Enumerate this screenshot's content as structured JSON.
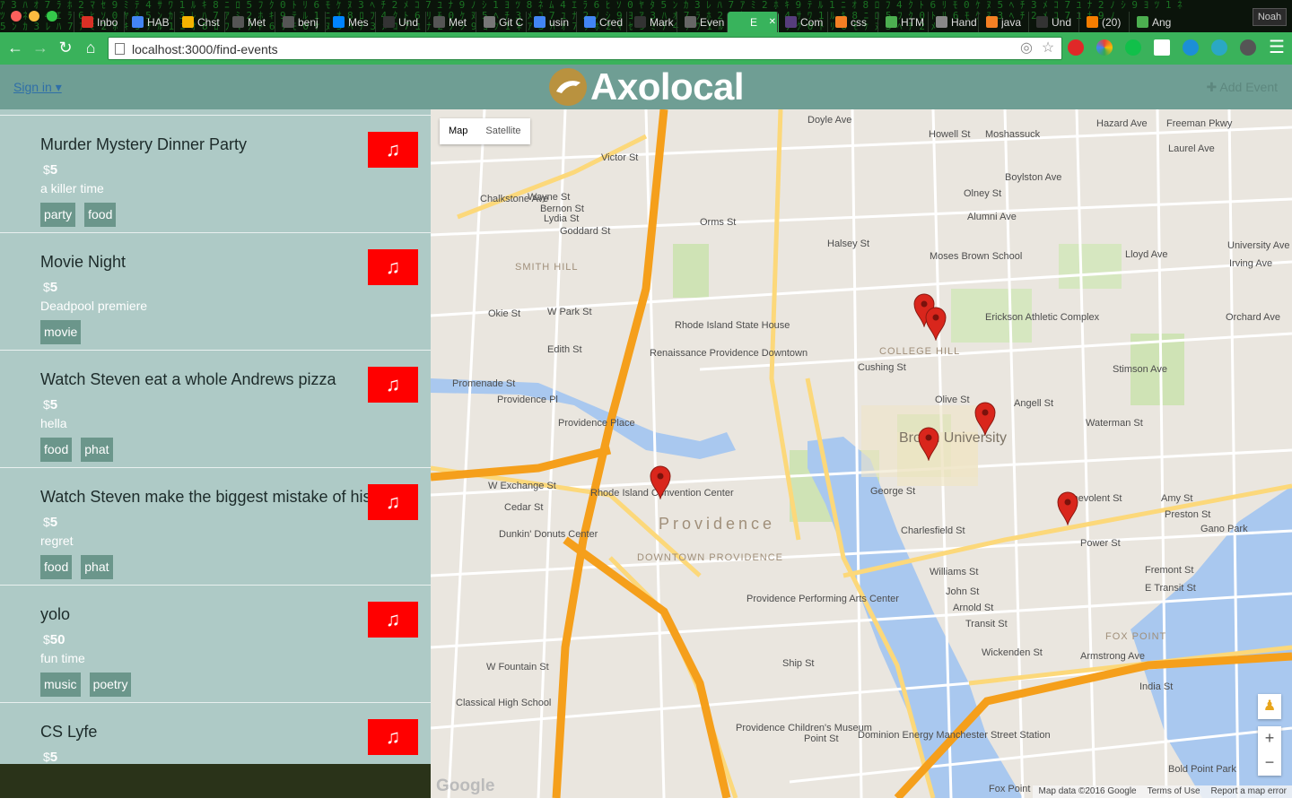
{
  "browser": {
    "profile_name": "Noah",
    "url": "localhost:3000/find-events",
    "tabs": [
      {
        "title": "Inbo",
        "color": "#d93025"
      },
      {
        "title": "HAB",
        "color": "#4285f4"
      },
      {
        "title": "Chst",
        "color": "#f4b400"
      },
      {
        "title": "Met",
        "color": "#555555"
      },
      {
        "title": "benj",
        "color": "#555555"
      },
      {
        "title": "Mes",
        "color": "#0084ff"
      },
      {
        "title": "Und",
        "color": "#333333"
      },
      {
        "title": "Met",
        "color": "#555555"
      },
      {
        "title": "Git C",
        "color": "#777777"
      },
      {
        "title": "usin",
        "color": "#4285f4"
      },
      {
        "title": "Cred",
        "color": "#4285f4"
      },
      {
        "title": "Mark",
        "color": "#333333"
      },
      {
        "title": "Even",
        "color": "#666666"
      },
      {
        "title": "E",
        "color": "#38b35c",
        "active": true
      },
      {
        "title": "Com",
        "color": "#563d7c"
      },
      {
        "title": "css",
        "color": "#f48024"
      },
      {
        "title": "HTM",
        "color": "#4caf50"
      },
      {
        "title": "Hand",
        "color": "#888888"
      },
      {
        "title": "java",
        "color": "#f48024"
      },
      {
        "title": "Und",
        "color": "#333333"
      },
      {
        "title": "(20)",
        "color": "#f57d00"
      },
      {
        "title": "Ang",
        "color": "#4caf50"
      }
    ]
  },
  "header": {
    "signin_label": "Sign in ▾",
    "brand": "Axolocal",
    "add_event_label": "✚ Add Event"
  },
  "events": [
    {
      "title": "Murder Mystery Dinner Party",
      "price": "5",
      "description": "a killer time",
      "tags": [
        "party",
        "food"
      ]
    },
    {
      "title": "Movie Night",
      "price": "5",
      "description": "Deadpool premiere",
      "tags": [
        "movie"
      ]
    },
    {
      "title": "Watch Steven eat a whole Andrews pizza",
      "price": "5",
      "description": "hella",
      "tags": [
        "food",
        "phat"
      ]
    },
    {
      "title": "Watch Steven make the biggest mistake of his life",
      "price": "5",
      "description": "regret",
      "tags": [
        "food",
        "phat"
      ]
    },
    {
      "title": "yolo",
      "price": "50",
      "description": "fun time",
      "tags": [
        "music",
        "poetry"
      ]
    },
    {
      "title": "CS Lyfe",
      "price": "5",
      "description": "",
      "tags": []
    }
  ],
  "event_button_icon": "♫",
  "map": {
    "toggle": [
      "Map",
      "Satellite"
    ],
    "labels": [
      "Doyle Ave",
      "Howell St",
      "Moshassuck",
      "Hazard Ave",
      "Freeman Pkwy",
      "Laurel Ave",
      "Victor St",
      "Olney St",
      "Boylston Ave",
      "Alumni Ave",
      "Orms St",
      "Chalkstone Ave",
      "Wayne St",
      "Bernon St",
      "Lydia St",
      "Goddard St",
      "SMITH HILL",
      "Moses Brown School",
      "Lloyd Ave",
      "University Ave",
      "Irving Ave",
      "Halsey St",
      "Okie St",
      "W Park St",
      "Edith St",
      "Rhode Island State House",
      "Erickson Athletic Complex",
      "COLLEGE HILL",
      "Orchard Ave",
      "Angell St",
      "Renaissance Providence Downtown",
      "Cushing St",
      "Stimson Ave",
      "Promenade St",
      "Providence Pl",
      "Olive St",
      "Providence Place",
      "Waterman St",
      "Brown University",
      "W Exchange St",
      "Rhode Island Convention Center",
      "Cedar St",
      "Dunkin' Donuts Center",
      "Providence",
      "George St",
      "Benevolent St",
      "Amy St",
      "Preston St",
      "Gano Park",
      "Charlesfield St",
      "Power St",
      "DOWNTOWN PROVIDENCE",
      "Providence Performing Arts Center",
      "Williams St",
      "John St",
      "Arnold St",
      "Transit St",
      "Fremont St",
      "E Transit St",
      "FOX POINT",
      "W Fountain St",
      "Wickenden St",
      "Armstrong Ave",
      "India St",
      "Classical High School",
      "Ship St",
      "Providence Children's Museum",
      "Point St",
      "Dominion Energy Manchester Street Station",
      "Bold Point Park",
      "Fox Point"
    ],
    "attribution": [
      "Map data ©2016 Google",
      "Terms of Use",
      "Report a map error"
    ],
    "google_logo": "Google",
    "zoom_in": "+",
    "zoom_out": "−"
  }
}
